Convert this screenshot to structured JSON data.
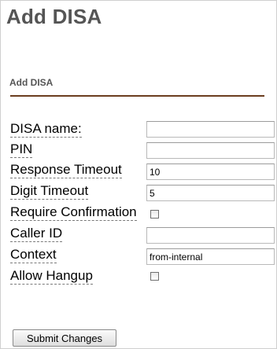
{
  "page": {
    "title": "Add DISA"
  },
  "section": {
    "title": "Add DISA"
  },
  "form": {
    "disa_name": {
      "label": "DISA name:",
      "value": ""
    },
    "pin": {
      "label": "PIN",
      "value": ""
    },
    "response_timeout": {
      "label": "Response Timeout",
      "value": "10"
    },
    "digit_timeout": {
      "label": "Digit Timeout",
      "value": "5"
    },
    "require_confirmation": {
      "label": "Require Confirmation",
      "checked": false
    },
    "caller_id": {
      "label": "Caller ID",
      "value": ""
    },
    "context": {
      "label": "Context",
      "value": "from-internal"
    },
    "allow_hangup": {
      "label": "Allow Hangup",
      "checked": false
    }
  },
  "actions": {
    "submit_label": "Submit Changes"
  }
}
